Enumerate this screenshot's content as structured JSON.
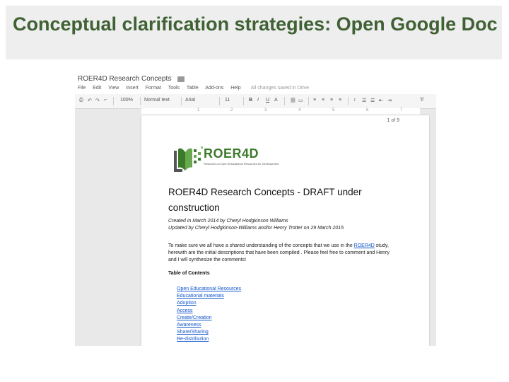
{
  "slide": {
    "title": "Conceptual clarification strategies: Open Google Doc"
  },
  "gdoc": {
    "doc_title": "ROER4D Research Concepts",
    "menu": [
      "File",
      "Edit",
      "View",
      "Insert",
      "Format",
      "Tools",
      "Table",
      "Add-ons",
      "Help"
    ],
    "saved_note": "All changes saved in Drive",
    "toolbar": {
      "zoom": "100%",
      "style": "Normal text",
      "font": "Arial",
      "size": "11"
    },
    "ruler": [
      "1",
      "2",
      "3",
      "4",
      "5",
      "6",
      "7"
    ],
    "page": {
      "page_count": "1 of 9",
      "logo_name": "ROER4D",
      "logo_sub": "Research on Open Educational Resources for Development",
      "heading": "ROER4D Research Concepts - DRAFT under construction",
      "meta_line1": "Created in March 2014 by Cheryl Hodgkinson Williams",
      "meta_line2": "Updated by Cheryl Hodgkinson-Williams and/or Henry Trotter on 29 March 2015",
      "intro_before": "To make sure we all have a shared understanding of the concepts that we use in the ",
      "intro_link": "ROER4D",
      "intro_after": " study, herewith are the initial descriptions that have been compiled . Please feel free to comment and Henry and I will synthesize the comments!",
      "toc_title": "Table of Contents",
      "toc": [
        "Open Educational Resources",
        "Educational materials",
        "Adoption",
        "Access",
        "Create/Creation",
        "Awareness",
        "Share/Sharing",
        "Re-distribution"
      ]
    }
  },
  "colors": {
    "title": "#3f6134",
    "title_bar": "#eeeeee",
    "link": "#1155cc",
    "logo_green": "#3b7a2a"
  }
}
